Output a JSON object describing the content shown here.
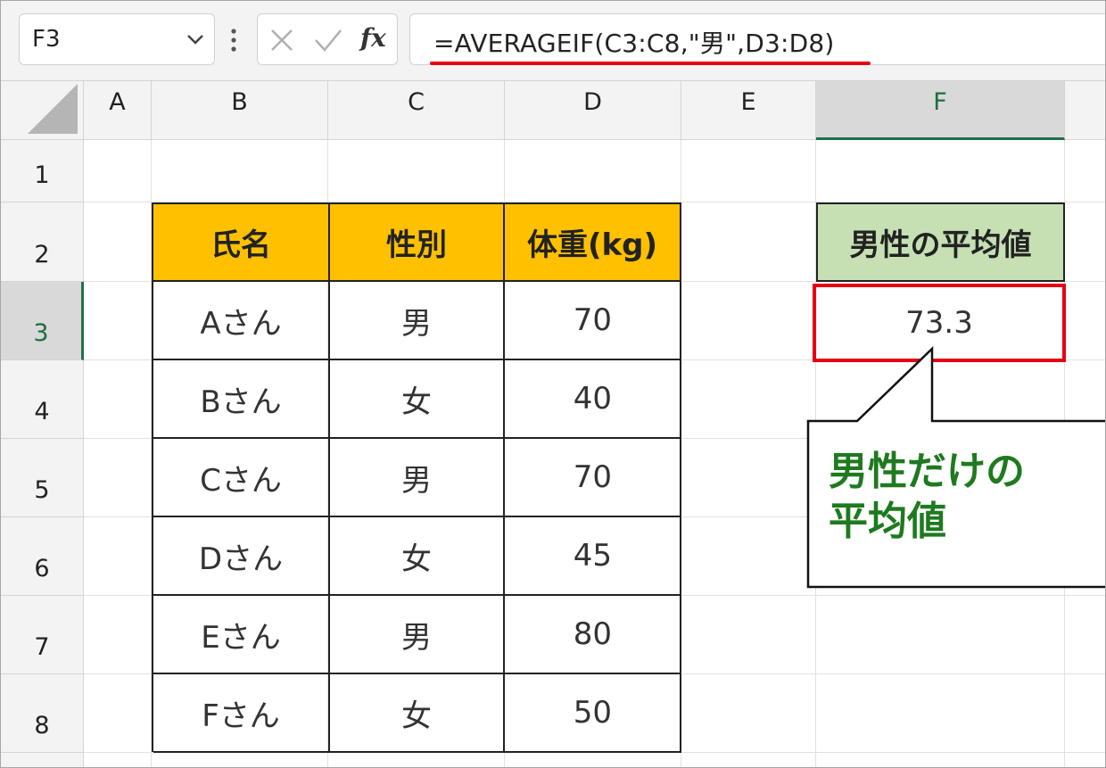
{
  "namebox": {
    "value": "F3"
  },
  "formula_bar": {
    "fx_label": "fx",
    "formula": "=AVERAGEIF(C3:C8,\"男\",D3:D8)"
  },
  "columns": [
    "A",
    "B",
    "C",
    "D",
    "E",
    "F"
  ],
  "selected_column": "F",
  "rows": [
    "1",
    "2",
    "3",
    "4",
    "5",
    "6",
    "7",
    "8"
  ],
  "selected_row": "3",
  "table": {
    "headers": [
      "氏名",
      "性別",
      "体重(kg)"
    ],
    "rows": [
      [
        "Aさん",
        "男",
        "70"
      ],
      [
        "Bさん",
        "女",
        "40"
      ],
      [
        "Cさん",
        "男",
        "70"
      ],
      [
        "Dさん",
        "女",
        "45"
      ],
      [
        "Eさん",
        "男",
        "80"
      ],
      [
        "Fさん",
        "女",
        "50"
      ]
    ]
  },
  "result": {
    "header": "男性の平均値",
    "value": "73.3"
  },
  "callout": {
    "text": "男性だけの\n平均値"
  },
  "colors": {
    "header_fill": "#ffc000",
    "result_header_fill": "#c6e0b4",
    "highlight_red": "#e60012",
    "callout_text": "#1e7a1e",
    "excel_green": "#1e7145"
  }
}
